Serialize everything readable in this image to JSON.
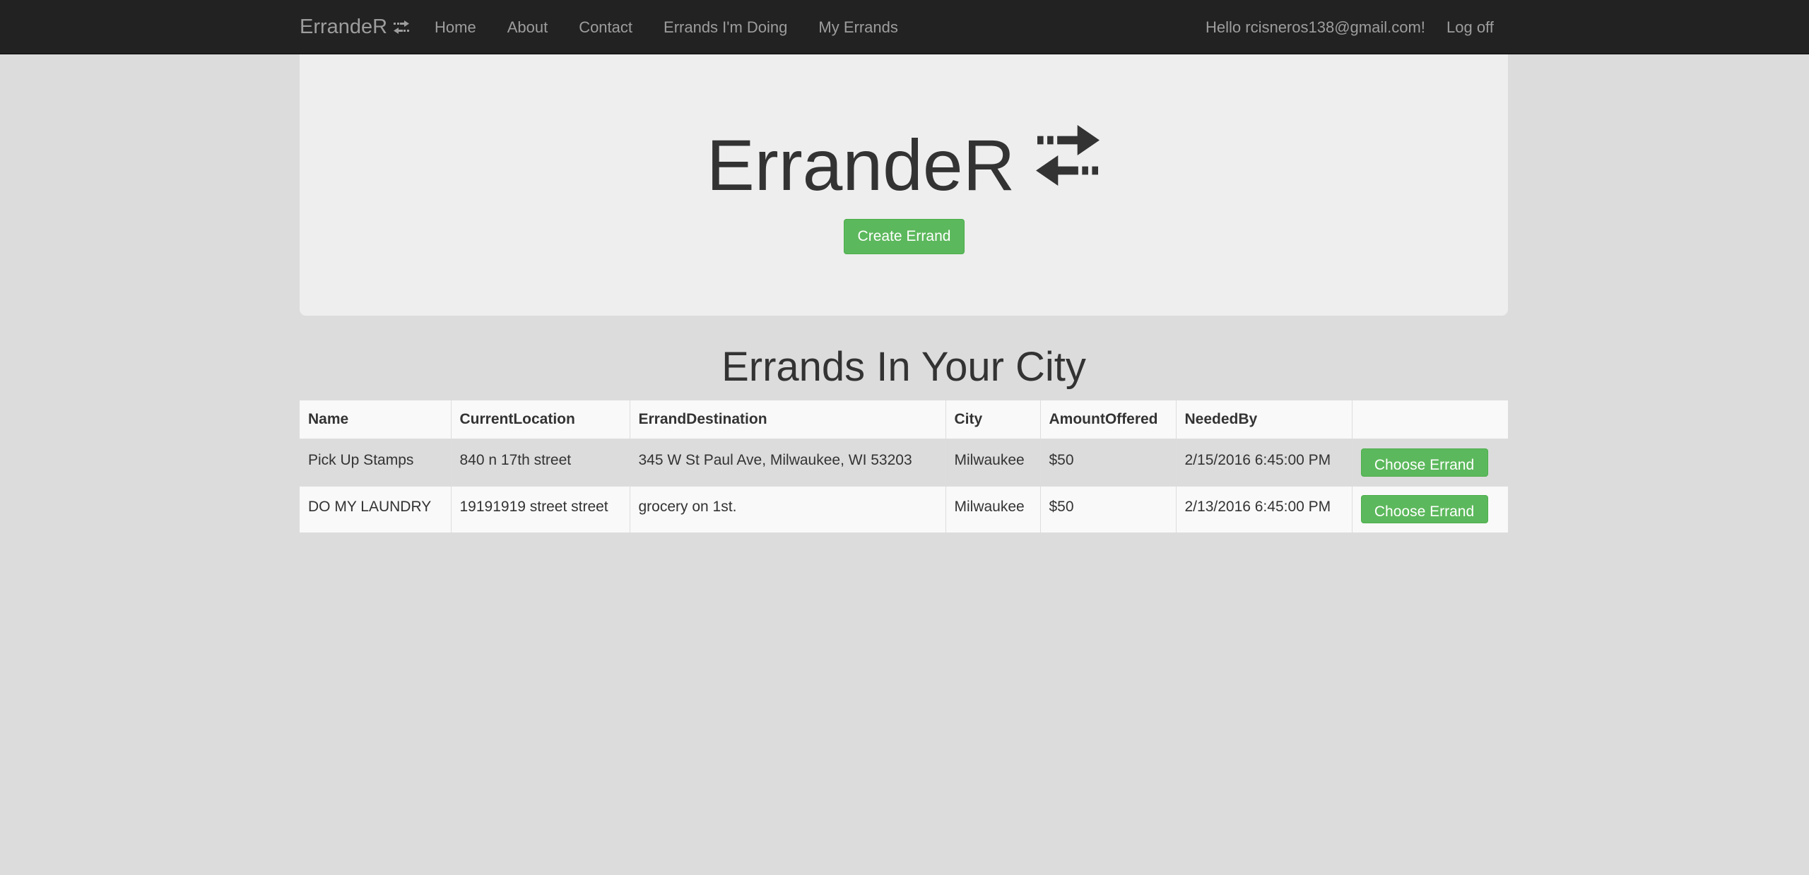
{
  "navbar": {
    "brand": "ErrandeR",
    "links": [
      {
        "label": "Home"
      },
      {
        "label": "About"
      },
      {
        "label": "Contact"
      },
      {
        "label": "Errands I'm Doing"
      },
      {
        "label": "My Errands"
      }
    ],
    "greeting": "Hello rcisneros138@gmail.com!",
    "logoff": "Log off"
  },
  "hero": {
    "title": "ErrandeR",
    "icon": "exchange-arrows-icon",
    "create_button": "Create Errand"
  },
  "section": {
    "title": "Errands In Your City"
  },
  "table": {
    "headers": [
      "Name",
      "CurrentLocation",
      "ErrandDestination",
      "City",
      "AmountOffered",
      "NeededBy",
      ""
    ],
    "rows": [
      {
        "name": "Pick Up Stamps",
        "current_location": "840 n 17th street",
        "destination": "345 W St Paul Ave, Milwaukee, WI 53203",
        "city": "Milwaukee",
        "amount": "$50",
        "needed_by": "2/15/2016 6:45:00 PM",
        "action": "Choose Errand"
      },
      {
        "name": "DO MY LAUNDRY",
        "current_location": "19191919 street street",
        "destination": "grocery on 1st.",
        "city": "Milwaukee",
        "amount": "$50",
        "needed_by": "2/13/2016 6:45:00 PM",
        "action": "Choose Errand"
      }
    ]
  },
  "colors": {
    "navbar_bg": "#222222",
    "nav_text": "#9d9d9d",
    "page_bg": "#dcdcdc",
    "jumbotron_bg": "#eeeeee",
    "button_green": "#5cb85c"
  }
}
